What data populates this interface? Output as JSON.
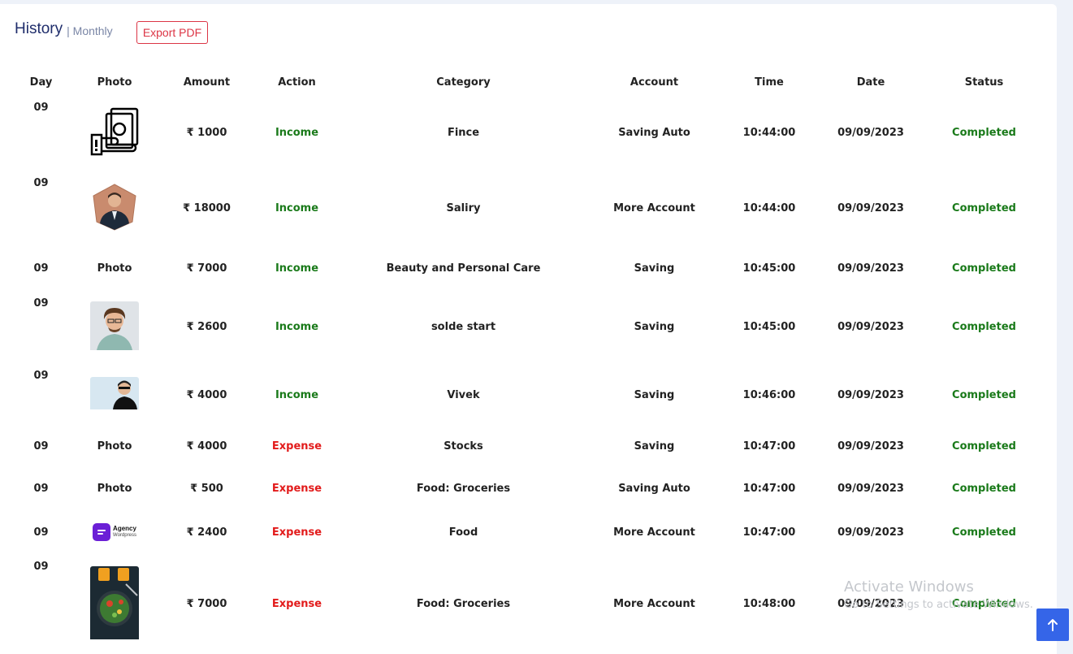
{
  "header": {
    "title": "History",
    "subtitle": "| Monthly",
    "export_label": "Export PDF"
  },
  "table": {
    "columns": [
      "Day",
      "Photo",
      "Amount",
      "Action",
      "Category",
      "Account",
      "Time",
      "Date",
      "Status"
    ],
    "rows": [
      {
        "day": "09",
        "photo": "money-icon",
        "amount": "₹ 1000",
        "action": "Income",
        "category": "Fince",
        "account": "Saving Auto",
        "time": "10:44:00",
        "date": "09/09/2023",
        "status": "Completed"
      },
      {
        "day": "09",
        "photo": "man-in-suit-photo",
        "amount": "₹ 18000",
        "action": "Income",
        "category": "Saliry",
        "account": "More Account",
        "time": "10:44:00",
        "date": "09/09/2023",
        "status": "Completed"
      },
      {
        "day": "09",
        "photo": "Photo",
        "amount": "₹ 7000",
        "action": "Income",
        "category": "Beauty and Personal Care",
        "account": "Saving",
        "time": "10:45:00",
        "date": "09/09/2023",
        "status": "Completed"
      },
      {
        "day": "09",
        "photo": "curly-hair-man-photo",
        "amount": "₹ 2600",
        "action": "Income",
        "category": "solde start",
        "account": "Saving",
        "time": "10:45:00",
        "date": "09/09/2023",
        "status": "Completed"
      },
      {
        "day": "09",
        "photo": "man-sunglasses-photo",
        "amount": "₹ 4000",
        "action": "Income",
        "category": "Vivek",
        "account": "Saving",
        "time": "10:46:00",
        "date": "09/09/2023",
        "status": "Completed"
      },
      {
        "day": "09",
        "photo": "Photo",
        "amount": "₹ 4000",
        "action": "Expense",
        "category": "Stocks",
        "account": "Saving",
        "time": "10:47:00",
        "date": "09/09/2023",
        "status": "Completed"
      },
      {
        "day": "09",
        "photo": "Photo",
        "amount": "₹ 500",
        "action": "Expense",
        "category": "Food: Groceries",
        "account": "Saving Auto",
        "time": "10:47:00",
        "date": "09/09/2023",
        "status": "Completed"
      },
      {
        "day": "09",
        "photo": "agency-logo",
        "amount": "₹ 2400",
        "action": "Expense",
        "category": "Food",
        "account": "More Account",
        "time": "10:47:00",
        "date": "09/09/2023",
        "status": "Completed"
      },
      {
        "day": "09",
        "photo": "salad-photo",
        "amount": "₹ 7000",
        "action": "Expense",
        "category": "Food: Groceries",
        "account": "More Account",
        "time": "10:48:00",
        "date": "09/09/2023",
        "status": "Completed"
      }
    ]
  },
  "agency_logo": {
    "name": "Agency",
    "tagline": "Wordpress"
  },
  "watermark": {
    "line1": "Activate Windows",
    "line2": "Go to Settings to activate Windows."
  },
  "colors": {
    "income": "#1a7a1a",
    "expense": "#e21b1b",
    "accent": "#3565e8",
    "title": "#1f2d6b"
  }
}
